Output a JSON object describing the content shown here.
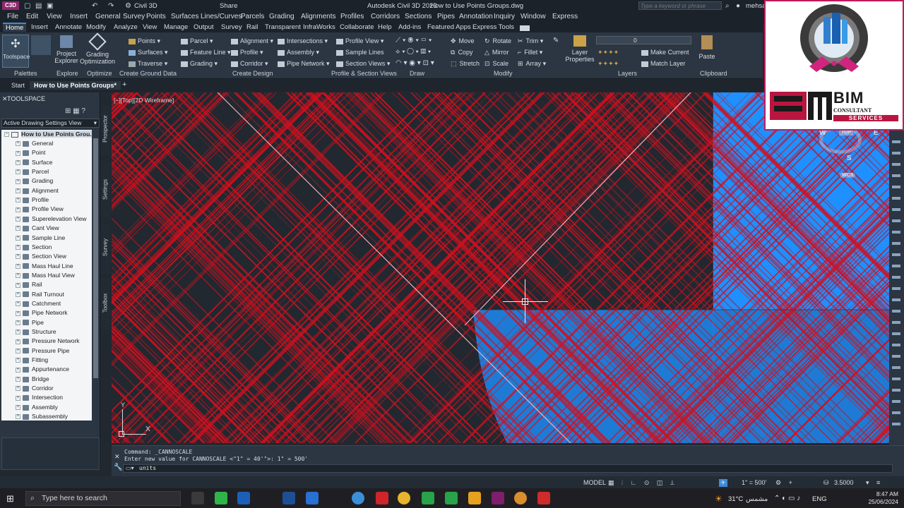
{
  "titlebar": {
    "app_badge": "C3D",
    "workspace": "Civil 3D",
    "share": "Share",
    "title_app": "Autodesk Civil 3D 2023",
    "title_file": "How to Use Points Groups.dwg",
    "search_placeholder": "Type a keyword or phrase",
    "user": "mehsa"
  },
  "menu": [
    "File",
    "Edit",
    "View",
    "Insert",
    "General",
    "Survey",
    "Points",
    "Surfaces",
    "Lines/Curves",
    "Parcels",
    "Grading",
    "Alignments",
    "Profiles",
    "Corridors",
    "Sections",
    "Pipes",
    "Annotation",
    "Inquiry",
    "Window",
    "Express"
  ],
  "ribbon_tabs": [
    "Home",
    "Insert",
    "Annotate",
    "Modify",
    "Analyze",
    "View",
    "Manage",
    "Output",
    "Survey",
    "Rail",
    "Transparent",
    "InfraWorks",
    "Collaborate",
    "Help",
    "Add-ins",
    "Featured Apps",
    "Express Tools"
  ],
  "ribbon": {
    "palettes": {
      "toolspace": "Toolspace",
      "group": "Palettes"
    },
    "explore": {
      "project_explorer": "Project Explorer",
      "group": "Explore"
    },
    "optimize": {
      "grading_optimization": "Grading Optimization",
      "group": "Optimize"
    },
    "ground": {
      "points": "Points",
      "surfaces": "Surfaces",
      "traverse": "Traverse",
      "group": "Create Ground Data"
    },
    "design": {
      "parcel": "Parcel",
      "feature_line": "Feature Line",
      "grading": "Grading",
      "alignment": "Alignment",
      "profile": "Profile",
      "corridor": "Corridor",
      "intersections": "Intersections",
      "assembly": "Assembly",
      "pipe_network": "Pipe Network",
      "group": "Create Design"
    },
    "sections": {
      "profile_view": "Profile View",
      "sample_lines": "Sample Lines",
      "section_views": "Section Views",
      "group": "Profile & Section Views"
    },
    "draw": {
      "group": "Draw"
    },
    "modify": {
      "move": "Move",
      "copy": "Copy",
      "stretch": "Stretch",
      "rotate": "Rotate",
      "mirror": "Mirror",
      "scale": "Scale",
      "trim": "Trim",
      "fillet": "Fillet",
      "array": "Array",
      "group": "Modify"
    },
    "layers": {
      "layer_properties": "Layer Properties",
      "current_layer": "0",
      "make_current": "Make Current",
      "match_layer": "Match Layer",
      "group": "Layers"
    },
    "clipboard": {
      "paste": "Paste",
      "group": "Clipboard"
    }
  },
  "doc_tabs": {
    "start": "Start",
    "active": "How to Use Points Groups*",
    "add": "+"
  },
  "toolspace": {
    "title": "TOOLSPACE",
    "view_select": "Active Drawing Settings View",
    "root": "How to Use Points Grou...",
    "items": [
      "General",
      "Point",
      "Surface",
      "Parcel",
      "Grading",
      "Alignment",
      "Profile",
      "Profile View",
      "Superelevation View",
      "Cant View",
      "Sample Line",
      "Section",
      "Section View",
      "Mass Haul Line",
      "Mass Haul View",
      "Rail",
      "Rail Turnout",
      "Catchment",
      "Pipe Network",
      "Pipe",
      "Structure",
      "Pressure Network",
      "Pressure Pipe",
      "Fitting",
      "Appurtenance",
      "Bridge",
      "Corridor",
      "Intersection",
      "Assembly",
      "Subassembly"
    ],
    "side_tabs": [
      "Prospector",
      "Settings",
      "Survey",
      "Toolbox"
    ]
  },
  "viewport": {
    "label": "[−][Top][2D Wireframe]",
    "viewcube": {
      "w": "W",
      "top": "TOP",
      "e": "E",
      "s": "S",
      "wcs": "WCS"
    },
    "ucs": {
      "x": "X",
      "y": "Y"
    }
  },
  "colors": {
    "hatch_red": "#d2101e",
    "blue_fill": "#1e90ff",
    "background": "#212830"
  },
  "command": {
    "line1": "Command: _CANNOSCALE",
    "line2": "Enter new value for CANNOSCALE <\"1\" = 40'\">: 1\" = 500'",
    "input": "units"
  },
  "statusbar": {
    "model": "MODEL",
    "scale": "1\" = 500'",
    "lineweight": "3.5000"
  },
  "taskbar": {
    "search": "Type here to search",
    "weather": "31°C",
    "weather_text": "مشمس",
    "lang": "ENG",
    "time": "8:47 AM",
    "date": "25/06/2024"
  },
  "brand": {
    "bim": "BIM",
    "consultant": "CONSULTANT",
    "services": "SERVICES"
  }
}
